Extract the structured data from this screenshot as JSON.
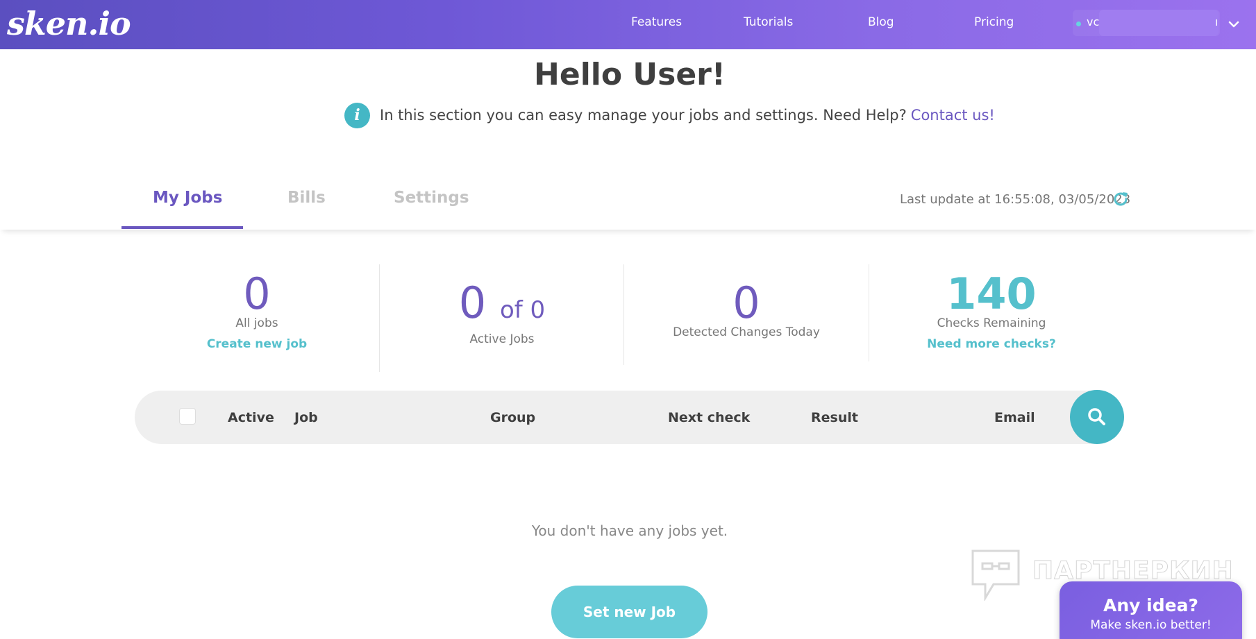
{
  "header": {
    "logo": "sken.io",
    "nav": [
      "Features",
      "Tutorials",
      "Blog",
      "Pricing"
    ],
    "user_prefix": "vc",
    "user_suffix": "ı"
  },
  "hero": {
    "title": "Hello User!",
    "info_text": "In this section you can easy manage your jobs and settings. Need Help?",
    "contact_link": "Contact us!"
  },
  "tabs": {
    "items": [
      {
        "label": "My Jobs",
        "active": true
      },
      {
        "label": "Bills",
        "active": false
      },
      {
        "label": "Settings",
        "active": false
      }
    ],
    "last_update": "Last update at 16:55:08, 03/05/2023"
  },
  "stats": {
    "all_jobs": {
      "value": "0",
      "label": "All jobs",
      "link": "Create new job"
    },
    "active_jobs": {
      "value": "0",
      "of": "of 0",
      "label": "Active Jobs"
    },
    "detected_changes": {
      "value": "0",
      "label": "Detected Changes Today"
    },
    "checks_remaining": {
      "value": "140",
      "label": "Checks Remaining",
      "link": "Need more checks?"
    }
  },
  "table": {
    "columns": [
      "Active",
      "Job",
      "Group",
      "Next check",
      "Result",
      "Email"
    ]
  },
  "empty_state": {
    "message": "You don't have any jobs yet.",
    "button": "Set new Job"
  },
  "watermark": "ПАРТНЕРКИН",
  "feedback": {
    "title": "Any idea?",
    "subtitle": "Make sken.io better!"
  },
  "colors": {
    "brand_purple": "#6a57c0",
    "accent_teal": "#44b7c5",
    "nav_gradient_start": "#5b4fc0",
    "nav_gradient_end": "#9b72ee"
  }
}
